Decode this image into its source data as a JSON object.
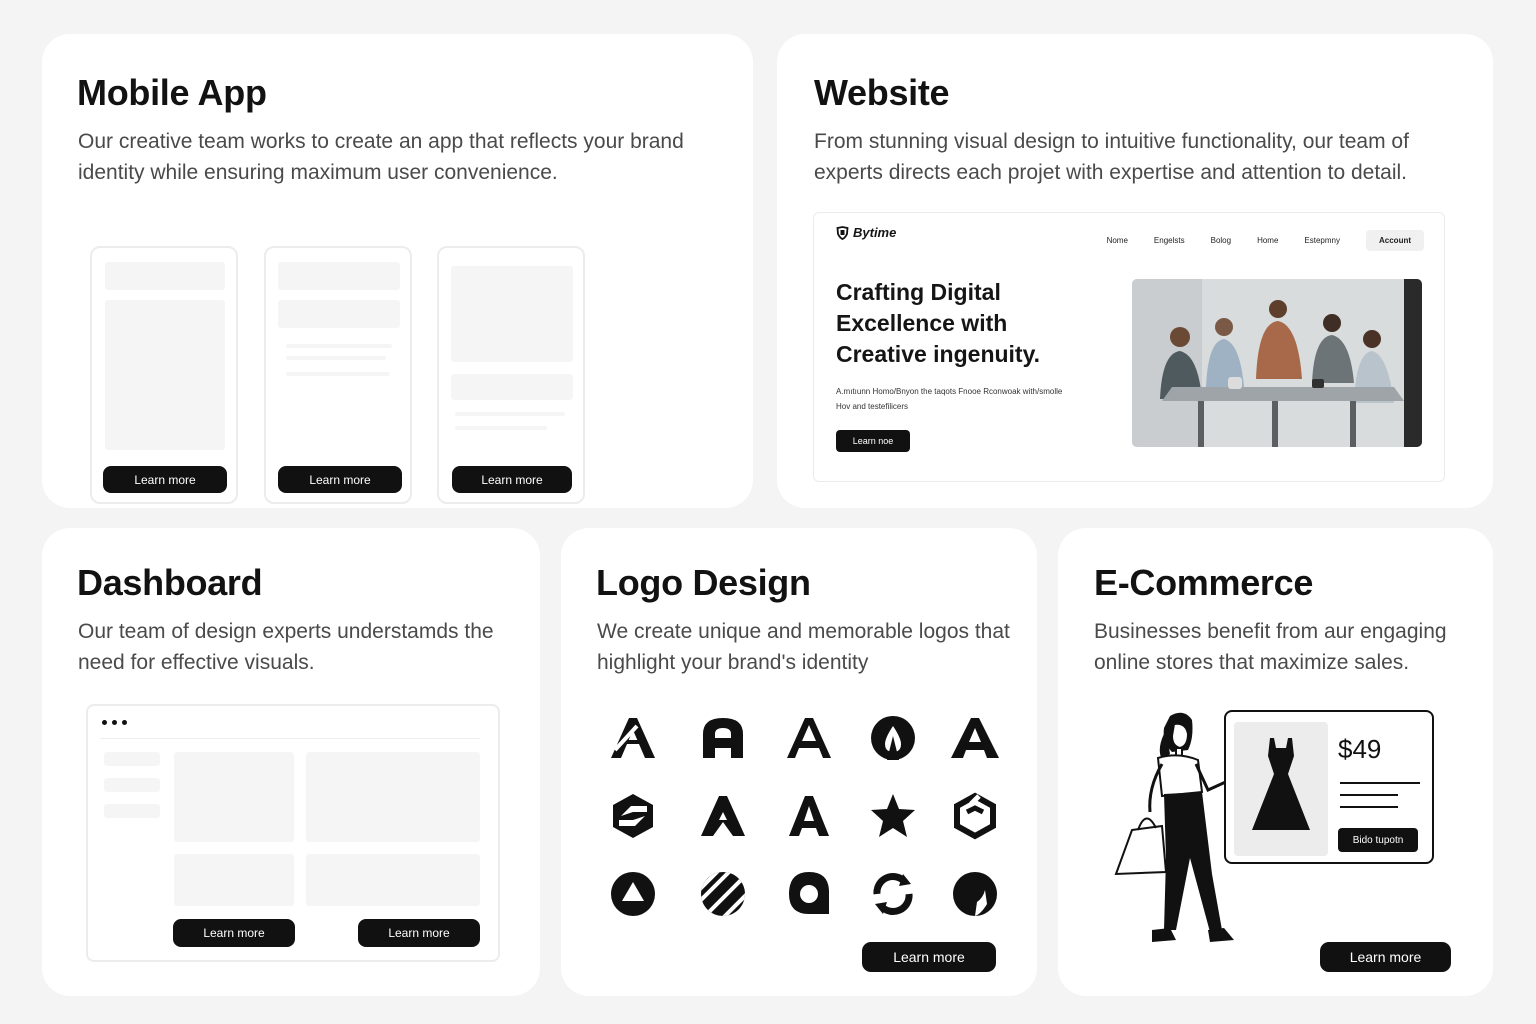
{
  "mobile_app": {
    "title": "Mobile App",
    "description": "Our creative team works to create an app that reflects your brand identity while ensuring maximum user convenience.",
    "buttons": [
      "Learn more",
      "Learn more",
      "Learn more"
    ]
  },
  "website": {
    "title": "Website",
    "description": "From stunning visual design to intuitive functionality, our team of experts directs each projet with expertise and attention to detail.",
    "mock": {
      "brand": "Bytime",
      "nav": [
        "Nome",
        "Engelsts",
        "Bolog",
        "Home",
        "Estepmny"
      ],
      "account": "Account",
      "headline": "Crafting Digital Excellence with Creative ingenuity.",
      "subtext": "A.mıtıunn Homo/Bnyon the taqots Fnooe Rconwoak with/smolle Hov and testefilicers",
      "button": "Learn noe"
    }
  },
  "dashboard": {
    "title": "Dashboard",
    "description": "Our team of design experts understamds the need for effective visuals.",
    "buttons": [
      "Learn more",
      "Learn more"
    ]
  },
  "logo_design": {
    "title": "Logo Design",
    "description": "We create unique and memorable logos that highlight your brand's identity",
    "button": "Learn more",
    "logo_icons": [
      "a-stencil-icon",
      "a-bold-icon",
      "a-outline-icon",
      "drop-circle-icon",
      "a-wide-icon",
      "hexagon-swirl-icon",
      "a-split-icon",
      "a-serif-icon",
      "star-icon",
      "cube-outline-icon",
      "triangle-circle-icon",
      "striped-circle-icon",
      "speech-bubble-icon",
      "refresh-circle-icon",
      "crescent-drop-icon"
    ]
  },
  "ecommerce": {
    "title": "E-Commerce",
    "description": "Businesses benefit from aur engaging online stores that maximize sales.",
    "price": "$49",
    "product_button": "Bido tupotn",
    "button": "Learn more"
  }
}
